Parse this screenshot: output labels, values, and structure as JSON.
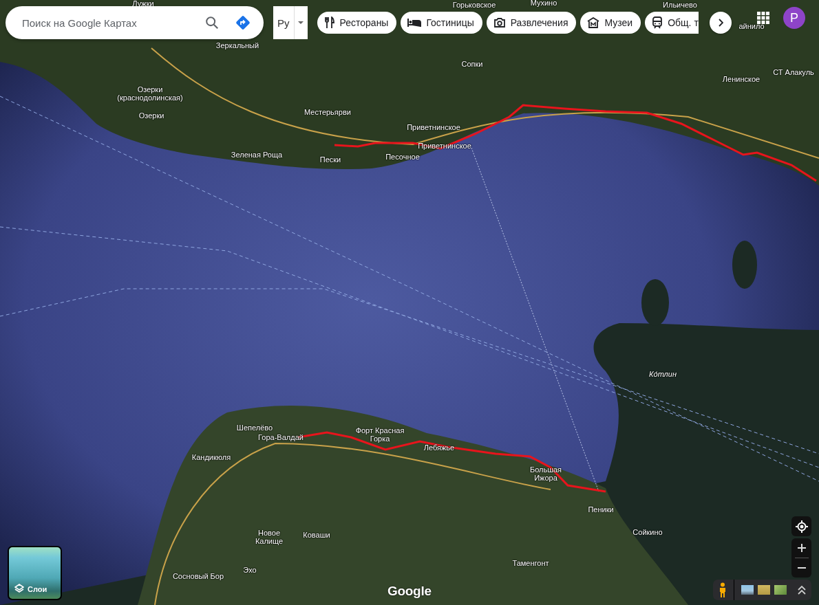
{
  "search": {
    "placeholder": "Поиск на Google Картах"
  },
  "language_button": {
    "label": "Ру"
  },
  "chips": [
    {
      "kind": "restaurant",
      "label": "Рестораны"
    },
    {
      "kind": "hotel",
      "label": "Гостиницы"
    },
    {
      "kind": "camera",
      "label": "Развлечения"
    },
    {
      "kind": "museum",
      "label": "Музеи"
    },
    {
      "kind": "transit",
      "label": "Общ. т"
    }
  ],
  "avatar": {
    "letter": "P"
  },
  "map_labels": [
    {
      "kind": "town",
      "text": "Лужки"
    },
    {
      "kind": "town",
      "text": "Горьковское"
    },
    {
      "kind": "town",
      "text": "Мухино"
    },
    {
      "kind": "town",
      "text": "Ильичево"
    },
    {
      "kind": "town",
      "text": "айнило"
    },
    {
      "kind": "town",
      "text": "Зеркальный"
    },
    {
      "kind": "town",
      "text": "Сопки"
    },
    {
      "kind": "town",
      "text": "Ленинское"
    },
    {
      "kind": "town",
      "text": "СТ Алакуль"
    },
    {
      "kind": "town",
      "text": "Озерки (краснодолинская)"
    },
    {
      "kind": "town",
      "text": "Озерки"
    },
    {
      "kind": "town",
      "text": "Местерьярви"
    },
    {
      "kind": "town",
      "text": "Приветнинское"
    },
    {
      "kind": "town",
      "text": "Приветнинское"
    },
    {
      "kind": "town",
      "text": "Зеленая Роща"
    },
    {
      "kind": "town",
      "text": "Пески"
    },
    {
      "kind": "town",
      "text": "Песочное"
    },
    {
      "kind": "island",
      "text": "Ко́тлин"
    },
    {
      "kind": "town",
      "text": "Шепелёво"
    },
    {
      "kind": "town",
      "text": "Гора-Валдай"
    },
    {
      "kind": "town",
      "text": "Форт Красная Горка"
    },
    {
      "kind": "town",
      "text": "Лебяжье"
    },
    {
      "kind": "town",
      "text": "Большая Ижора"
    },
    {
      "kind": "town",
      "text": "Кандикюля"
    },
    {
      "kind": "town",
      "text": "Пеники"
    },
    {
      "kind": "town",
      "text": "Новое Калище"
    },
    {
      "kind": "town",
      "text": "Коваши"
    },
    {
      "kind": "town",
      "text": "Сойкино"
    },
    {
      "kind": "town",
      "text": "Эхо"
    },
    {
      "kind": "town",
      "text": "Сосновый Бор"
    },
    {
      "kind": "town",
      "text": "Таменгонт"
    }
  ],
  "layers_button": {
    "label": "Слои"
  },
  "logo": {
    "text": "Google"
  }
}
